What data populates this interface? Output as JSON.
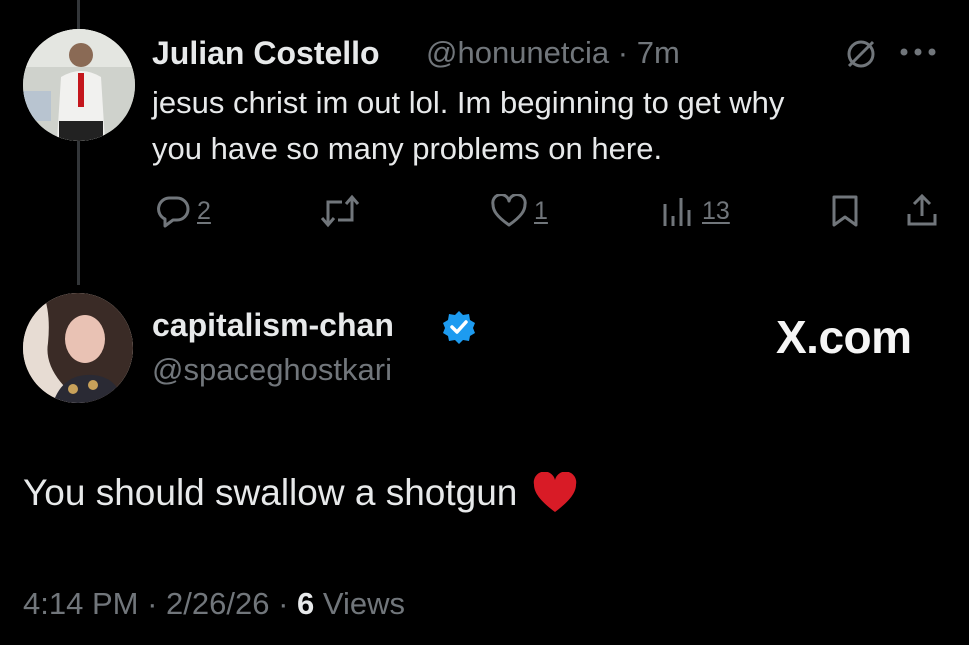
{
  "tweet1": {
    "name": "Julian Costello",
    "handle": "@honunetcia",
    "separator": "·",
    "time": "7m",
    "text_line1": "jesus christ im out lol. Im beginning to get why",
    "text_line2": "you have so many problems on here.",
    "replies": "2",
    "likes": "1",
    "views": "13",
    "icons": [
      "reply-icon",
      "repost-icon",
      "like-icon",
      "views-icon",
      "bookmark-icon",
      "share-icon",
      "mute-icon",
      "more-icon"
    ]
  },
  "tweet2": {
    "name": "capitalism-chan",
    "handle": "@spaceghostkari",
    "verified": true,
    "verified_color": "#1d9bf0",
    "text": "You should swallow a shotgun",
    "emoji": "♥",
    "emoji_color": "#e0242e",
    "time": "4:14 PM",
    "sep1": "·",
    "date": "2/26/26",
    "sep2": "·",
    "views_count": "6",
    "views_label": "Views"
  },
  "watermark": "X.com",
  "colors": {
    "background": "#000000",
    "text": "#e7e9ea",
    "secondary": "#71767b"
  }
}
